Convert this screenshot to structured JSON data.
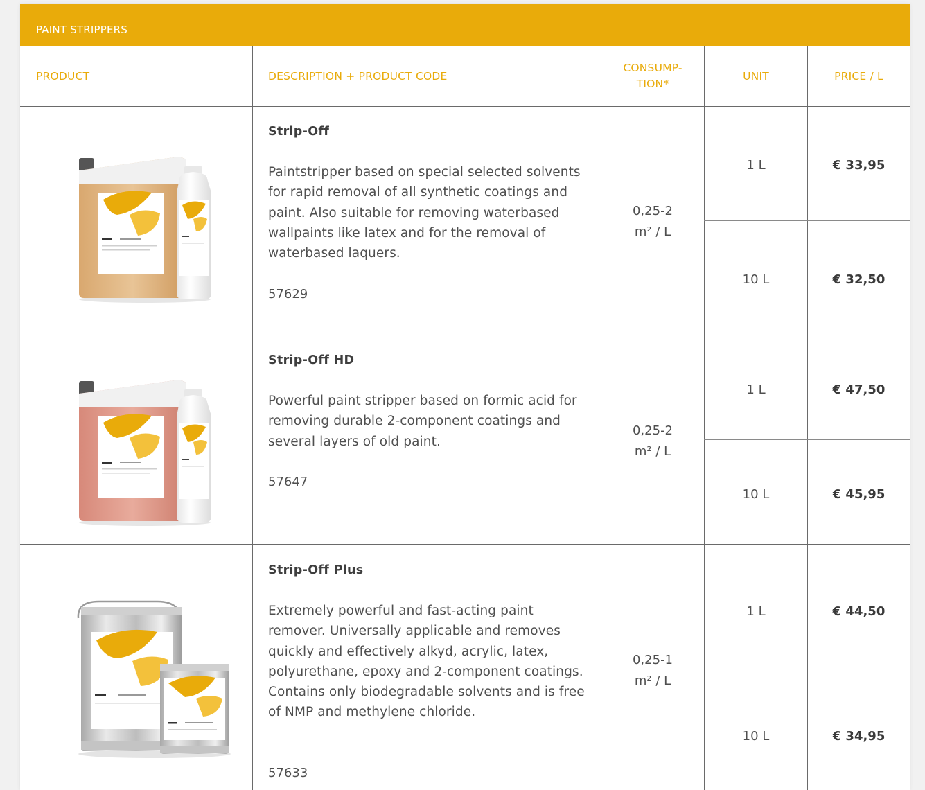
{
  "section_title": "PAINT STRIPPERS",
  "headers": {
    "product": "PRODUCT",
    "description": "DESCRIPTION + PRODUCT CODE",
    "consumption_1": "CONSUMP-",
    "consumption_2": "TION*",
    "unit": "UNIT",
    "price": "PRICE / L"
  },
  "colors": {
    "accent": "#e9ab0a",
    "grid": "#6a6a6a",
    "text": "#4f4f4f"
  },
  "products": [
    {
      "name": "Strip-Off",
      "description": "Paintstripper based on special selected solvents for rapid removal of all synthetic coatings and paint. Also suitable for removing waterbased wallpaints like latex and for the removal of waterbased laquers.",
      "code": "57629",
      "consumption_1": "0,25-2",
      "consumption_2": "m² / L",
      "image": "jerrycan-and-bottle-beige",
      "options": [
        {
          "unit": "1 L",
          "price": "€ 33,95"
        },
        {
          "unit": "10 L",
          "price": "€ 32,50"
        }
      ]
    },
    {
      "name": "Strip-Off HD",
      "description": "Powerful paint stripper based on formic acid for removing durable 2-component coatings and several layers of old paint.",
      "code": "57647",
      "consumption_1": "0,25-2",
      "consumption_2": "m² / L",
      "image": "jerrycan-and-bottle-pink",
      "options": [
        {
          "unit": "1 L",
          "price": "€ 47,50"
        },
        {
          "unit": "10 L",
          "price": "€ 45,95"
        }
      ]
    },
    {
      "name": "Strip-Off Plus",
      "description": "Extremely powerful and fast-acting paint remover. Universally applicable and removes quickly and effectively alkyd, acrylic, latex, polyurethane, epoxy and 2-component coatings. Contains only biodegradable solvents and is free of NMP and methylene chloride.",
      "code": "57633",
      "consumption_1": "0,25-1",
      "consumption_2": "m² / L",
      "image": "metal-cans-silver",
      "options": [
        {
          "unit": "1 L",
          "price": "€ 44,50"
        },
        {
          "unit": "10 L",
          "price": "€ 34,95"
        }
      ]
    }
  ]
}
